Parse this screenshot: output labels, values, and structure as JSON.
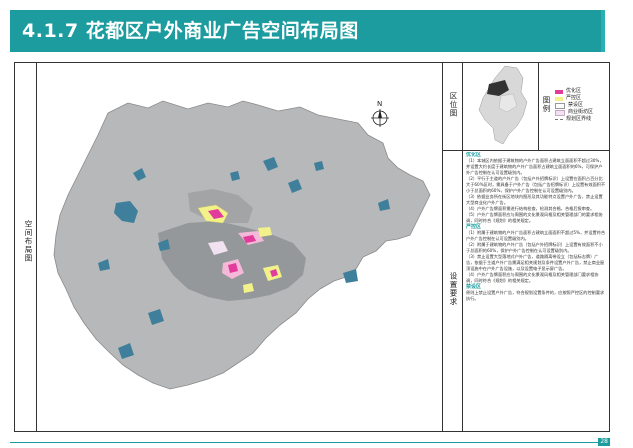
{
  "page": {
    "title": "4.1.7 花都区户外商业广告空间布局图",
    "page_number": "28"
  },
  "colors": {
    "header": "#1d9c9f",
    "map_gray": "#b7b8ba",
    "map_dark": "#8f9294",
    "water": "#3f7f9b",
    "optimize": "#e23b9c",
    "control": "#f3f28a",
    "restrict": "#f4b9d8",
    "commercial": "#f0e2f0",
    "boundary": "#9a9a9a"
  },
  "labels": {
    "left_strip": "空间布局图",
    "location_map": "区位图",
    "legend_label": "图例",
    "notes_label": "设置要求"
  },
  "legend": {
    "items": [
      {
        "label": "优化区",
        "color": "#e23b9c"
      },
      {
        "label": "严控区",
        "color": "#f3f28a"
      },
      {
        "label": "禁设区",
        "color": "#ffffff"
      },
      {
        "label": "商业街坊区",
        "color": "#f0e2f0"
      },
      {
        "label": "规划区界线",
        "color": "#ffffff"
      }
    ]
  },
  "compass": {
    "label": "N"
  },
  "notes": [
    {
      "type": "h",
      "text": "优化区"
    },
    {
      "type": "p",
      "text": "（1）本城区内依据于建筑物的户外广告面积占建筑立面面积不超过30%，并设置大约长度于建筑物的户外广告面积占建筑立面面积的6%，可保护户外广告控制在认可设置级别内。"
    },
    {
      "type": "p",
      "text": "（2）平行于主道的户外广告（包括户外招牌标识）上设置在面积占百分比大于60%区时，需具备于户外广告（包括广告招牌标识）上设置有效面积不小于总面积的60%，保护户外广告控制在认可设置级别内。"
    },
    {
      "type": "p",
      "text": "（3）依据业务所在街区地块内图形及其功能特点设置户外广告，禁止设置大型商业化户外广告。"
    },
    {
      "type": "p",
      "text": "（4）户外广告牌面积需进行结构检查，检测其合格，合格后报审查。"
    },
    {
      "type": "p",
      "text": "（5）户外广告牌面积应与周围的文化景观风格及相关管理部门的要求相协调，同时符合《规划》的相关规定。"
    },
    {
      "type": "h",
      "text": "严控区"
    },
    {
      "type": "p",
      "text": "（1）附属于建筑物的户外广告面积占建筑立面面积不超过5%，并设置符合户外广告控制在认可设置级别内。"
    },
    {
      "type": "p",
      "text": "（2）附属于建筑物的户外广告（包括户外招牌标识）上设置有效面积不小于总面积的60%，保护户外广告控制在认可设置级别内。"
    },
    {
      "type": "p",
      "text": "（3）禁止设置大型落地式户外广告，道路隔离带设立（包括标志牌）广告，依据于主道户外广告需满足相关规划及条件设置户外广告，禁止商业屋顶设施中在户外广告设施，以及设置电子显示屏广告。"
    },
    {
      "type": "p",
      "text": "（4）户外广告牌面积应与周围的文化景观风格及相关管理部门要求相协调，同时符合《规划》的相关规定。"
    },
    {
      "type": "h",
      "text": "禁设区"
    },
    {
      "type": "p",
      "text": "原则上禁止设置户外广告，符合规划设置条件的，应按照严控区的控制要求执行。"
    }
  ]
}
